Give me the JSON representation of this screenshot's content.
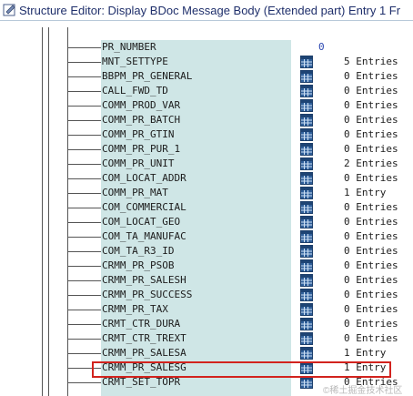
{
  "window": {
    "title": "Structure Editor: Display BDoc Message Body (Extended part) Entry 1 Fr"
  },
  "tree": {
    "rows": [
      {
        "name": "PR_NUMBER",
        "count": "0",
        "has_icon": false
      },
      {
        "name": "MNT_SETTYPE",
        "count": "5 Entries",
        "has_icon": true
      },
      {
        "name": "BBPM_PR_GENERAL",
        "count": "0 Entries",
        "has_icon": true
      },
      {
        "name": "CALL_FWD_TD",
        "count": "0 Entries",
        "has_icon": true
      },
      {
        "name": "COMM_PROD_VAR",
        "count": "0 Entries",
        "has_icon": true
      },
      {
        "name": "COMM_PR_BATCH",
        "count": "0 Entries",
        "has_icon": true
      },
      {
        "name": "COMM_PR_GTIN",
        "count": "0 Entries",
        "has_icon": true
      },
      {
        "name": "COMM_PR_PUR_1",
        "count": "0 Entries",
        "has_icon": true
      },
      {
        "name": "COMM_PR_UNIT",
        "count": "2 Entries",
        "has_icon": true
      },
      {
        "name": "COM_LOCAT_ADDR",
        "count": "0 Entries",
        "has_icon": true
      },
      {
        "name": "COMM_PR_MAT",
        "count": "1 Entry",
        "has_icon": true
      },
      {
        "name": "COM_COMMERCIAL",
        "count": "0 Entries",
        "has_icon": true
      },
      {
        "name": "COM_LOCAT_GEO",
        "count": "0 Entries",
        "has_icon": true
      },
      {
        "name": "COM_TA_MANUFAC",
        "count": "0 Entries",
        "has_icon": true
      },
      {
        "name": "COM_TA_R3_ID",
        "count": "0 Entries",
        "has_icon": true
      },
      {
        "name": "CRMM_PR_PSOB",
        "count": "0 Entries",
        "has_icon": true
      },
      {
        "name": "CRMM_PR_SALESH",
        "count": "0 Entries",
        "has_icon": true
      },
      {
        "name": "CRMM_PR_SUCCESS",
        "count": "0 Entries",
        "has_icon": true
      },
      {
        "name": "CRMM_PR_TAX",
        "count": "0 Entries",
        "has_icon": true
      },
      {
        "name": "CRMT_CTR_DURA",
        "count": "0 Entries",
        "has_icon": true
      },
      {
        "name": "CRMT_CTR_TREXT",
        "count": "0 Entries",
        "has_icon": true
      },
      {
        "name": "CRMM_PR_SALESA",
        "count": "1 Entry",
        "has_icon": true
      },
      {
        "name": "CRMM_PR_SALESG",
        "count": "1 Entry",
        "has_icon": true
      },
      {
        "name": "CRMT_SET_TOPR",
        "count": "0 Entries",
        "has_icon": true
      }
    ]
  },
  "watermark": "©稀土掘金技术社区",
  "colors": {
    "label_background": "#cfe6e6",
    "highlight_border": "#d2231e",
    "count_blue": "#2a46b0",
    "title_text": "#1f2f6b"
  }
}
